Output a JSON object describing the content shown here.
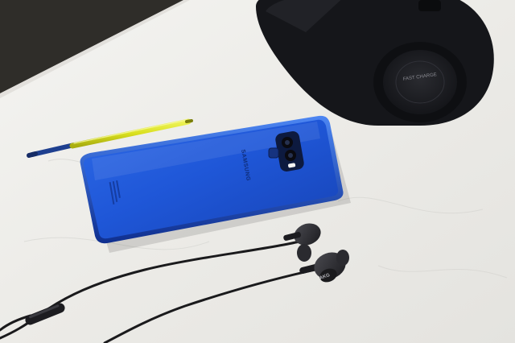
{
  "photo": {
    "objects": [
      "stylus",
      "smartphone",
      "wireless-charger",
      "earphones"
    ],
    "colors": {
      "tabletop": "#efefec",
      "background_wall": "#2f2d29",
      "phone_blue": "#1f57d8",
      "stylus_yellow": "#d9df1e",
      "charger_black": "#15161a",
      "cable_black": "#1a1a1c"
    }
  },
  "phone": {
    "brand_text": "SAMSUNG"
  },
  "charger": {
    "pad_text": "FAST CHARGE"
  },
  "earbud": {
    "logo_text": "AKG"
  }
}
